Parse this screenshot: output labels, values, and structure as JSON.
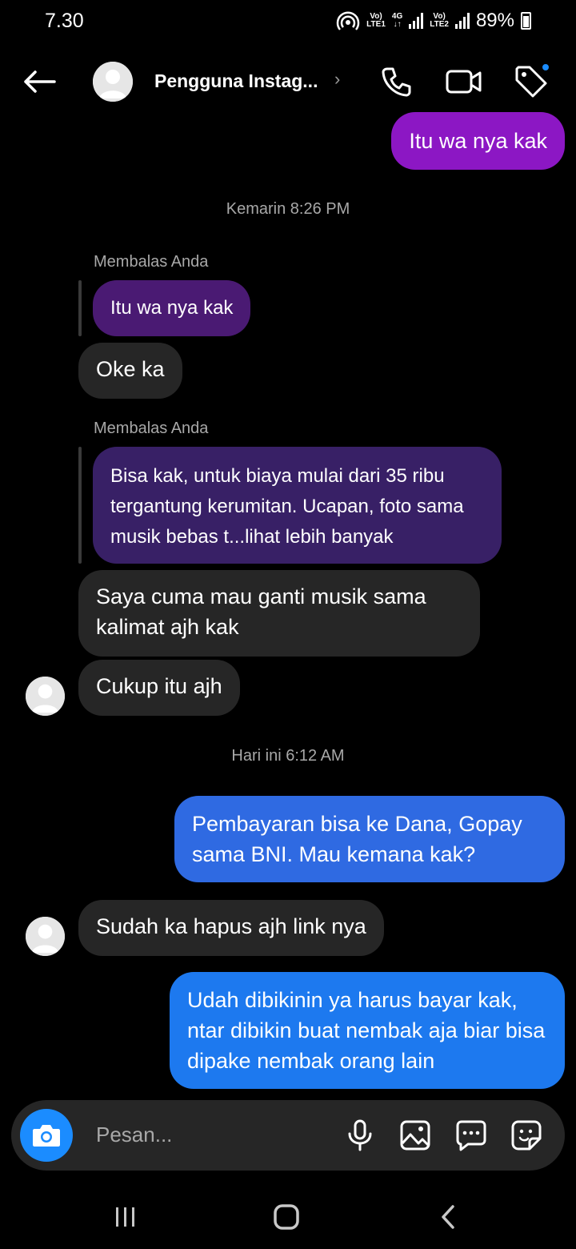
{
  "status_bar": {
    "time": "7.30",
    "sim1_top": "Vo)",
    "sim1_bottom": "LTE1",
    "net_top": "4G",
    "net_bottom": "↓↑",
    "sim2_top": "Vo)",
    "sim2_bottom": "LTE2",
    "battery": "89%"
  },
  "header": {
    "contact_name": "Pengguna Instag...",
    "chevron": "›"
  },
  "messages": {
    "m1": "Itu wa nya kak",
    "ts1": "Kemarin 8:26 PM",
    "reply_label_1": "Membalas Anda",
    "quoted_1": "Itu wa nya kak",
    "m2": "Oke ka",
    "reply_label_2": "Membalas Anda",
    "quoted_2": "Bisa kak, untuk biaya mulai dari 35 ribu tergantung kerumitan. Ucapan, foto sama musik bebas t...lihat lebih banyak",
    "m3": "Saya cuma mau ganti musik sama kalimat ajh kak",
    "m4": "Cukup itu ajh",
    "ts2": "Hari ini 6:12 AM",
    "m5": "Pembayaran bisa ke Dana, Gopay sama BNI. Mau kemana kak?",
    "m6": "Sudah ka hapus ajh link nya",
    "m7": "Udah dibikinin ya harus bayar kak, ntar dibikin buat nembak aja biar bisa dipake nembak orang lain"
  },
  "composer": {
    "placeholder": "Pesan..."
  },
  "icons": {
    "back": "back-arrow-icon",
    "call": "phone-icon",
    "video": "video-icon",
    "tag": "tag-icon",
    "camera": "camera-icon",
    "mic": "microphone-icon",
    "gallery": "gallery-icon",
    "chat": "chat-bubble-icon",
    "sticker": "sticker-icon"
  },
  "colors": {
    "background": "#000000",
    "sent_purple": "#8c17c4",
    "sent_blue": "#2f6ae2",
    "received": "#262626",
    "accent": "#1b8cff"
  }
}
